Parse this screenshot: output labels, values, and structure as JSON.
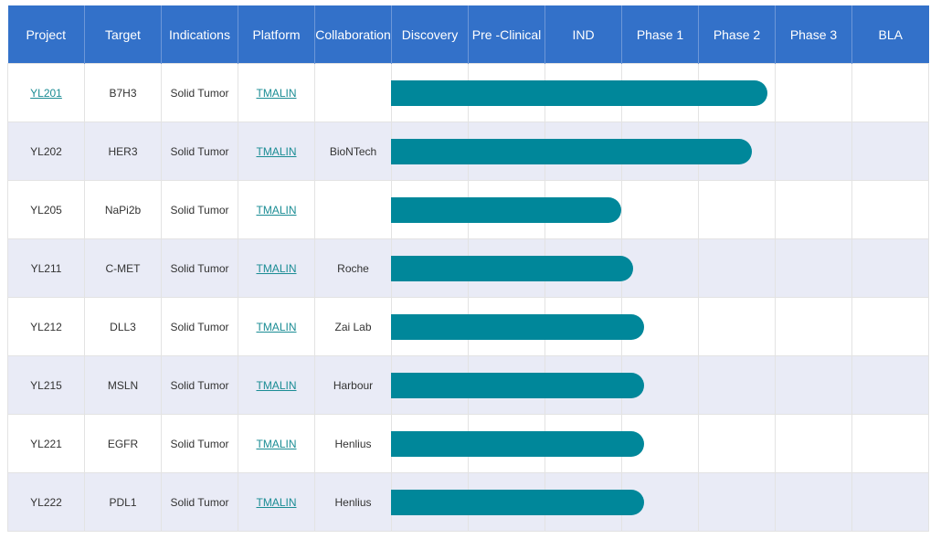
{
  "table": {
    "headers": [
      "Project",
      "Target",
      "Indications",
      "Platform",
      "Collaboration",
      "Discovery",
      "Pre -Clinical",
      "IND",
      "Phase 1",
      "Phase 2",
      "Phase 3",
      "BLA"
    ],
    "rows": [
      {
        "project": "YL201",
        "project_is_link": true,
        "target": "B7H3",
        "indication": "Solid Tumor",
        "platform": "TMALIN",
        "collaboration": "",
        "progress_stage": 4.9
      },
      {
        "project": "YL202",
        "project_is_link": false,
        "target": "HER3",
        "indication": "Solid Tumor",
        "platform": "TMALIN",
        "collaboration": "BioNTech",
        "progress_stage": 4.7
      },
      {
        "project": "YL205",
        "project_is_link": false,
        "target": "NaPi2b",
        "indication": "Solid Tumor",
        "platform": "TMALIN",
        "collaboration": "",
        "progress_stage": 3.0
      },
      {
        "project": "YL211",
        "project_is_link": false,
        "target": "C-MET",
        "indication": "Solid Tumor",
        "platform": "TMALIN",
        "collaboration": "Roche",
        "progress_stage": 3.15
      },
      {
        "project": "YL212",
        "project_is_link": false,
        "target": "DLL3",
        "indication": "Solid Tumor",
        "platform": "TMALIN",
        "collaboration": "Zai Lab",
        "progress_stage": 3.3
      },
      {
        "project": "YL215",
        "project_is_link": false,
        "target": "MSLN",
        "indication": "Solid Tumor",
        "platform": "TMALIN",
        "collaboration": "Harbour",
        "progress_stage": 3.3
      },
      {
        "project": "YL221",
        "project_is_link": false,
        "target": "EGFR",
        "indication": "Solid Tumor",
        "platform": "TMALIN",
        "collaboration": "Henlius",
        "progress_stage": 3.3
      },
      {
        "project": "YL222",
        "project_is_link": false,
        "target": "PDL1",
        "indication": "Solid Tumor",
        "platform": "TMALIN",
        "collaboration": "Henlius",
        "progress_stage": 3.3
      }
    ]
  },
  "colors": {
    "header_bg": "#3371c9",
    "bar": "#00879a",
    "link": "#1a8c94",
    "row_alt": "#e9ebf6"
  }
}
